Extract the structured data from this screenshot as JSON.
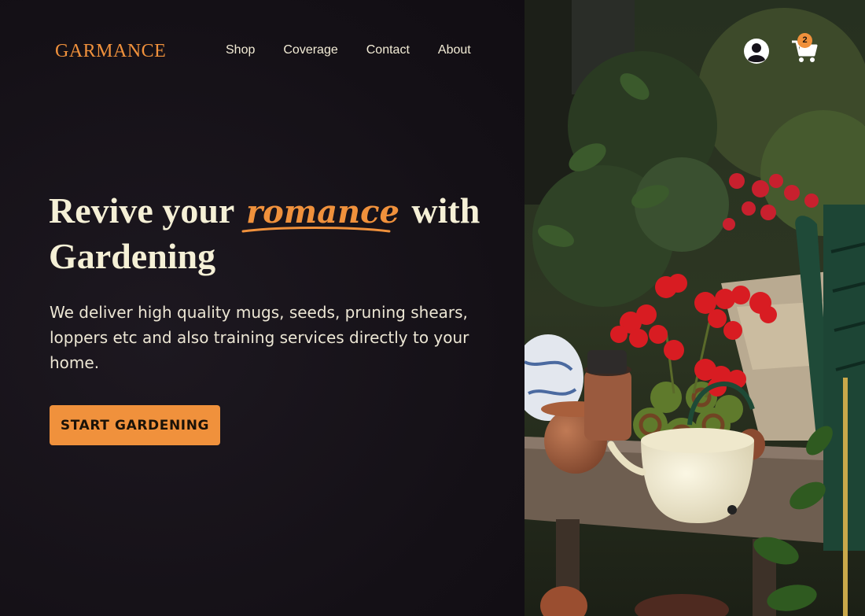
{
  "brand": {
    "name": "GARMANCE"
  },
  "nav": {
    "items": [
      "Shop",
      "Coverage",
      "Contact",
      "About"
    ]
  },
  "header": {
    "account_icon": "user-circle-icon",
    "cart_icon": "shopping-cart-icon",
    "cart_count": "2"
  },
  "hero": {
    "headline_before": "Revive your",
    "headline_accent": "romance",
    "headline_after": "with Gardening",
    "description": "We deliver high quality mugs, seeds, pruning shears, loppers etc and also training services directly to your home.",
    "cta_label": "START GARDENING"
  },
  "colors": {
    "accent": "#f0913c",
    "background": "#16121a",
    "text": "#f3ecd6"
  }
}
